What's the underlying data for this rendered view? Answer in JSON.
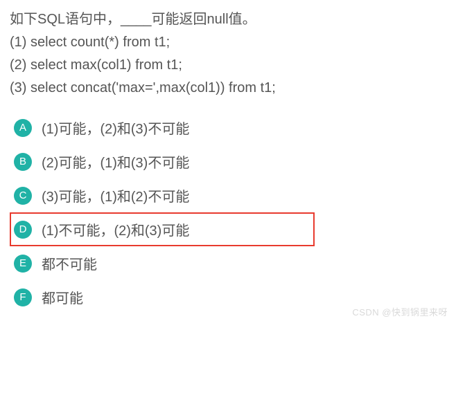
{
  "question": {
    "lines": [
      "如下SQL语句中，____可能返回null值。",
      "(1) select count(*) from t1;",
      "(2) select max(col1) from t1;",
      "(3) select concat('max=',max(col1)) from t1;"
    ]
  },
  "options": [
    {
      "letter": "A",
      "text": "(1)可能，(2)和(3)不可能",
      "highlight": false
    },
    {
      "letter": "B",
      "text": "(2)可能，(1)和(3)不可能",
      "highlight": false
    },
    {
      "letter": "C",
      "text": "(3)可能，(1)和(2)不可能",
      "highlight": false
    },
    {
      "letter": "D",
      "text": "(1)不可能，(2)和(3)可能",
      "highlight": true
    },
    {
      "letter": "E",
      "text": "都不可能",
      "highlight": false
    },
    {
      "letter": "F",
      "text": "都可能",
      "highlight": false
    }
  ],
  "watermark": "CSDN @快到锅里来呀"
}
